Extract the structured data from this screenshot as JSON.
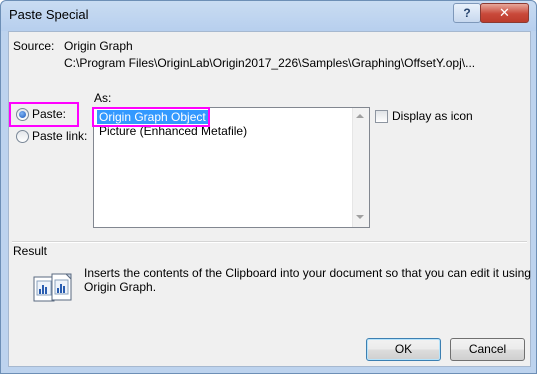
{
  "dialog": {
    "title": "Paste Special",
    "help_label": "?",
    "close_label": "✕"
  },
  "source": {
    "label": "Source:",
    "name": "Origin Graph",
    "path": "C:\\Program Files\\OriginLab\\Origin2017_226\\Samples\\Graphing\\OffsetY.opj\\..."
  },
  "paste_mode": {
    "paste_label": "Paste:",
    "paste_link_label": "Paste link:",
    "selected": "Paste:"
  },
  "as": {
    "label": "As:",
    "items": [
      "Origin Graph Object",
      "Picture (Enhanced Metafile)"
    ],
    "selected": "Origin Graph Object"
  },
  "display_as_icon": {
    "label": "Display as icon",
    "checked": false
  },
  "result": {
    "label": "Result",
    "line1": "Inserts the contents of the Clipboard into your document so that you can edit it using",
    "line2": "Origin Graph."
  },
  "buttons": {
    "ok": "OK",
    "cancel": "Cancel"
  },
  "colors": {
    "highlight": "#ff00ff",
    "selection": "#3399ff"
  }
}
